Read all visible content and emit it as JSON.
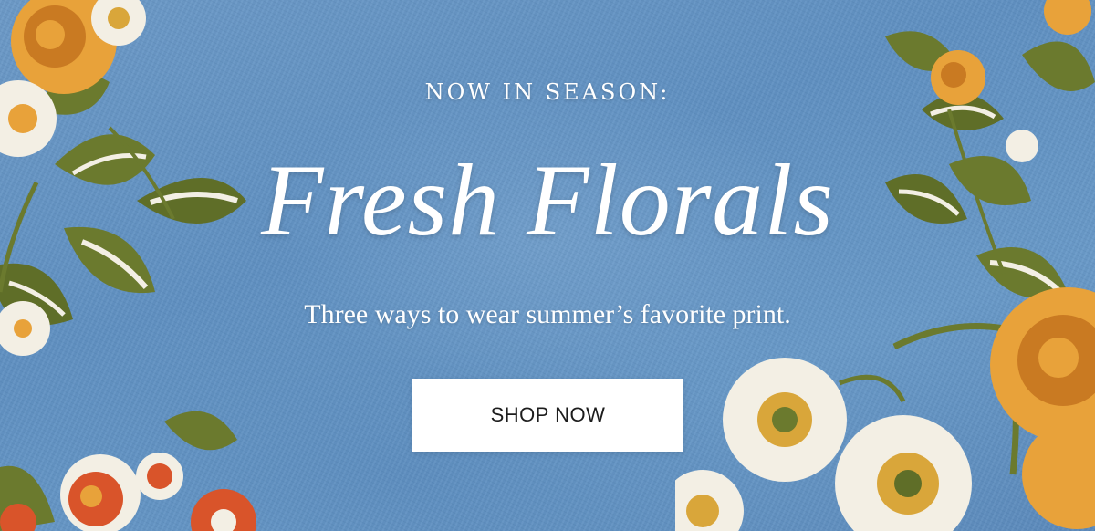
{
  "banner": {
    "eyebrow": "NOW IN SEASON:",
    "headline": "Fresh Florals",
    "subhead": "Three ways to wear summer’s favorite print.",
    "cta_label": "SHOP NOW"
  },
  "colors": {
    "background": "#6a98c6",
    "text": "#ffffff",
    "button_bg": "#ffffff",
    "button_text": "#1d1d1d",
    "petal_orange": "#e8a23a",
    "petal_red": "#d9542a",
    "petal_white": "#f3efe4",
    "leaf_green": "#6b7a2e"
  }
}
